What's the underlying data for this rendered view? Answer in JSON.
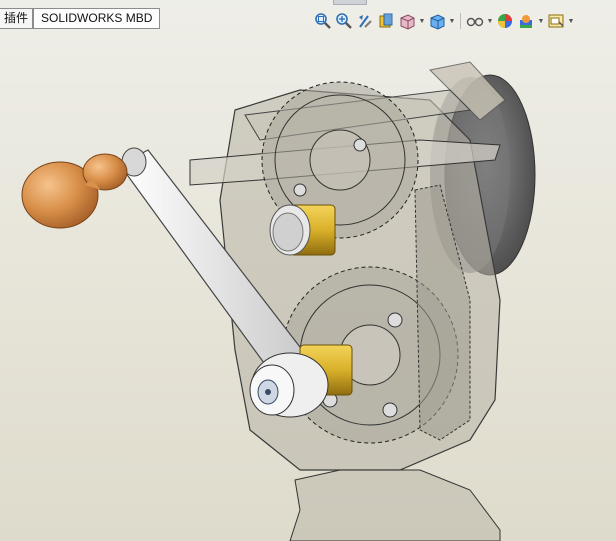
{
  "tabs": [
    {
      "label": "插件",
      "active": false
    },
    {
      "label": "SOLIDWORKS MBD",
      "active": true
    }
  ],
  "heads_up_toolbar": [
    {
      "icon": "zoom-to-fit-icon",
      "has_dropdown": false
    },
    {
      "icon": "zoom-to-area-icon",
      "has_dropdown": false
    },
    {
      "icon": "previous-view-icon",
      "has_dropdown": false
    },
    {
      "icon": "section-view-icon",
      "has_dropdown": false
    },
    {
      "icon": "view-orientation-icon",
      "has_dropdown": true
    },
    {
      "icon": "display-style-icon",
      "has_dropdown": true
    },
    {
      "icon": "hide-show-items-icon",
      "has_dropdown": true
    },
    {
      "icon": "edit-appearance-icon",
      "has_dropdown": false
    },
    {
      "icon": "apply-scene-icon",
      "has_dropdown": true
    },
    {
      "icon": "view-settings-icon",
      "has_dropdown": true
    }
  ],
  "viewport": {
    "model": "hand-crank gear mechanism (transparent housing)",
    "colors": {
      "handle": "#d9904a",
      "brass_shaft": "#d9b02a",
      "crank_arm": "#e2e2e2",
      "housing": "#b8b3a6",
      "grinding_wheel": "#6f6f6f"
    }
  }
}
